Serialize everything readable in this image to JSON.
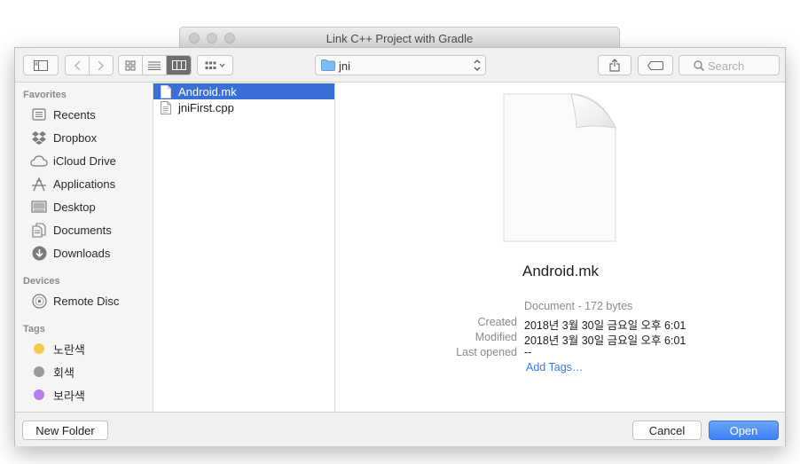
{
  "window": {
    "title": "Link C++ Project with Gradle"
  },
  "toolbar": {
    "path_folder": "jni",
    "search_placeholder": "Search"
  },
  "sidebar": {
    "favorites_heading": "Favorites",
    "favorites": [
      {
        "label": "Recents",
        "icon": "recents-icon"
      },
      {
        "label": "Dropbox",
        "icon": "dropbox-icon"
      },
      {
        "label": "iCloud Drive",
        "icon": "cloud-icon"
      },
      {
        "label": "Applications",
        "icon": "applications-icon"
      },
      {
        "label": "Desktop",
        "icon": "desktop-icon"
      },
      {
        "label": "Documents",
        "icon": "documents-icon"
      },
      {
        "label": "Downloads",
        "icon": "downloads-icon"
      }
    ],
    "devices_heading": "Devices",
    "devices": [
      {
        "label": "Remote Disc",
        "icon": "disc-icon"
      }
    ],
    "tags_heading": "Tags",
    "tags": [
      {
        "label": "노란색",
        "color": "#f2c94c"
      },
      {
        "label": "회색",
        "color": "#9a9a9a"
      },
      {
        "label": "보라색",
        "color": "#b67ee8"
      }
    ]
  },
  "files": [
    {
      "name": "Android.mk",
      "selected": true
    },
    {
      "name": "jniFirst.cpp",
      "selected": false
    }
  ],
  "preview": {
    "name": "Android.mk",
    "kind": "Document - 172 bytes",
    "created_label": "Created",
    "created_value": "2018년 3월 30일 금요일 오후 6:01",
    "modified_label": "Modified",
    "modified_value": "2018년 3월 30일 금요일 오후 6:01",
    "last_opened_label": "Last opened",
    "last_opened_value": "--",
    "add_tags": "Add Tags…"
  },
  "footer": {
    "new_folder": "New Folder",
    "cancel": "Cancel",
    "open": "Open"
  },
  "colors": {
    "selection": "#3a6fd8",
    "primary_button": "#3c80f6",
    "link": "#3b78e0"
  }
}
